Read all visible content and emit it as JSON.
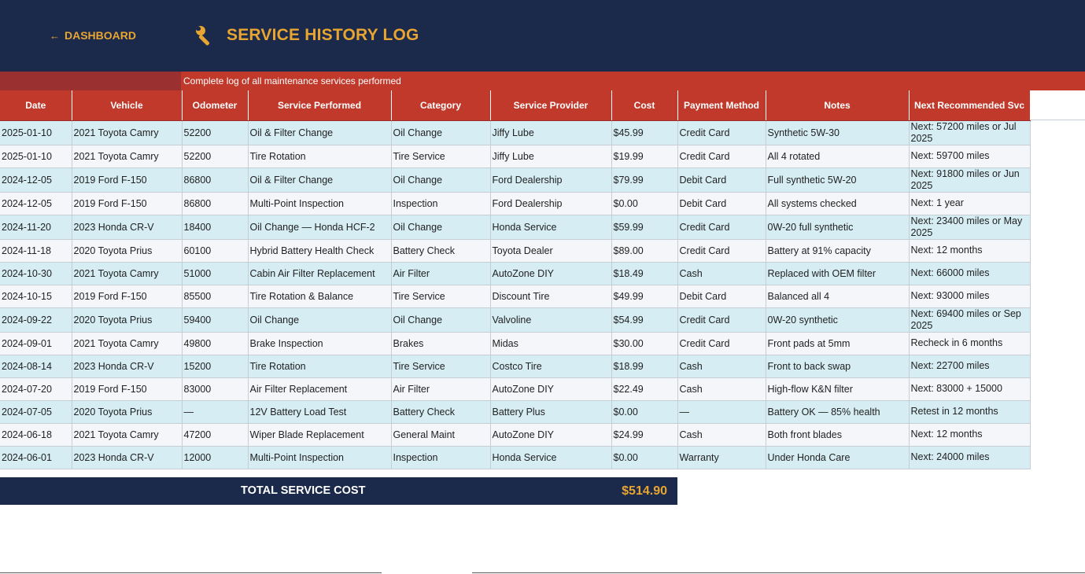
{
  "header": {
    "back_label": "DASHBOARD",
    "back_arrow": "←",
    "title": "SERVICE HISTORY LOG",
    "icon": "wrench-icon",
    "colors": {
      "navy": "#1b2a4a",
      "accent": "#e8a531",
      "red": "#c0392b"
    }
  },
  "subtitle": "Complete log of all maintenance services performed",
  "table": {
    "columns": [
      "Date",
      "Vehicle",
      "Odometer",
      "Service Performed",
      "Category",
      "Service Provider",
      "Cost",
      "Payment Method",
      "Notes",
      "Next Recommended Svc"
    ],
    "rows": [
      [
        "2025-01-10",
        "2021 Toyota Camry",
        "52200",
        "Oil & Filter Change",
        "Oil Change",
        "Jiffy Lube",
        "$45.99",
        "Credit Card",
        "Synthetic 5W-30",
        "Next: 57200 miles or Jul 2025"
      ],
      [
        "2025-01-10",
        "2021 Toyota Camry",
        "52200",
        "Tire Rotation",
        "Tire Service",
        "Jiffy Lube",
        "$19.99",
        "Credit Card",
        "All 4 rotated",
        "Next: 59700 miles"
      ],
      [
        "2024-12-05",
        "2019 Ford F-150",
        "86800",
        "Oil & Filter Change",
        "Oil Change",
        "Ford Dealership",
        "$79.99",
        "Debit Card",
        "Full synthetic 5W-20",
        "Next: 91800 miles or Jun 2025"
      ],
      [
        "2024-12-05",
        "2019 Ford F-150",
        "86800",
        "Multi-Point Inspection",
        "Inspection",
        "Ford Dealership",
        "$0.00",
        "Debit Card",
        "All systems checked",
        "Next: 1 year"
      ],
      [
        "2024-11-20",
        "2023 Honda CR-V",
        "18400",
        "Oil Change — Honda HCF-2",
        "Oil Change",
        "Honda Service",
        "$59.99",
        "Credit Card",
        "0W-20 full synthetic",
        "Next: 23400 miles or May 2025"
      ],
      [
        "2024-11-18",
        "2020 Toyota Prius",
        "60100",
        "Hybrid Battery Health Check",
        "Battery Check",
        "Toyota Dealer",
        "$89.00",
        "Credit Card",
        "Battery at 91% capacity",
        "Next: 12 months"
      ],
      [
        "2024-10-30",
        "2021 Toyota Camry",
        "51000",
        "Cabin Air Filter Replacement",
        "Air Filter",
        "AutoZone DIY",
        "$18.49",
        "Cash",
        "Replaced with OEM filter",
        "Next: 66000 miles"
      ],
      [
        "2024-10-15",
        "2019 Ford F-150",
        "85500",
        "Tire Rotation & Balance",
        "Tire Service",
        "Discount Tire",
        "$49.99",
        "Debit Card",
        "Balanced all 4",
        "Next: 93000 miles"
      ],
      [
        "2024-09-22",
        "2020 Toyota Prius",
        "59400",
        "Oil Change",
        "Oil Change",
        "Valvoline",
        "$54.99",
        "Credit Card",
        "0W-20 synthetic",
        "Next: 69400 miles or Sep 2025"
      ],
      [
        "2024-09-01",
        "2021 Toyota Camry",
        "49800",
        "Brake Inspection",
        "Brakes",
        "Midas",
        "$30.00",
        "Credit Card",
        "Front pads at 5mm",
        "Recheck in 6 months"
      ],
      [
        "2024-08-14",
        "2023 Honda CR-V",
        "15200",
        "Tire Rotation",
        "Tire Service",
        "Costco Tire",
        "$18.99",
        "Cash",
        "Front to back swap",
        "Next: 22700 miles"
      ],
      [
        "2024-07-20",
        "2019 Ford F-150",
        "83000",
        "Air Filter Replacement",
        "Air Filter",
        "AutoZone DIY",
        "$22.49",
        "Cash",
        "High-flow K&N filter",
        "Next: 83000 + 15000"
      ],
      [
        "2024-07-05",
        "2020 Toyota Prius",
        "—",
        "12V Battery Load Test",
        "Battery Check",
        "Battery Plus",
        "$0.00",
        "—",
        "Battery OK — 85% health",
        "Retest in 12 months"
      ],
      [
        "2024-06-18",
        "2021 Toyota Camry",
        "47200",
        "Wiper Blade Replacement",
        "General Maint",
        "AutoZone DIY",
        "$24.99",
        "Cash",
        "Both front blades",
        "Next: 12 months"
      ],
      [
        "2024-06-01",
        "2023 Honda CR-V",
        "12000",
        "Multi-Point Inspection",
        "Inspection",
        "Honda Service",
        "$0.00",
        "Warranty",
        "Under Honda Care",
        "Next: 24000 miles"
      ]
    ]
  },
  "total": {
    "label": "TOTAL SERVICE COST",
    "value": "$514.90"
  }
}
